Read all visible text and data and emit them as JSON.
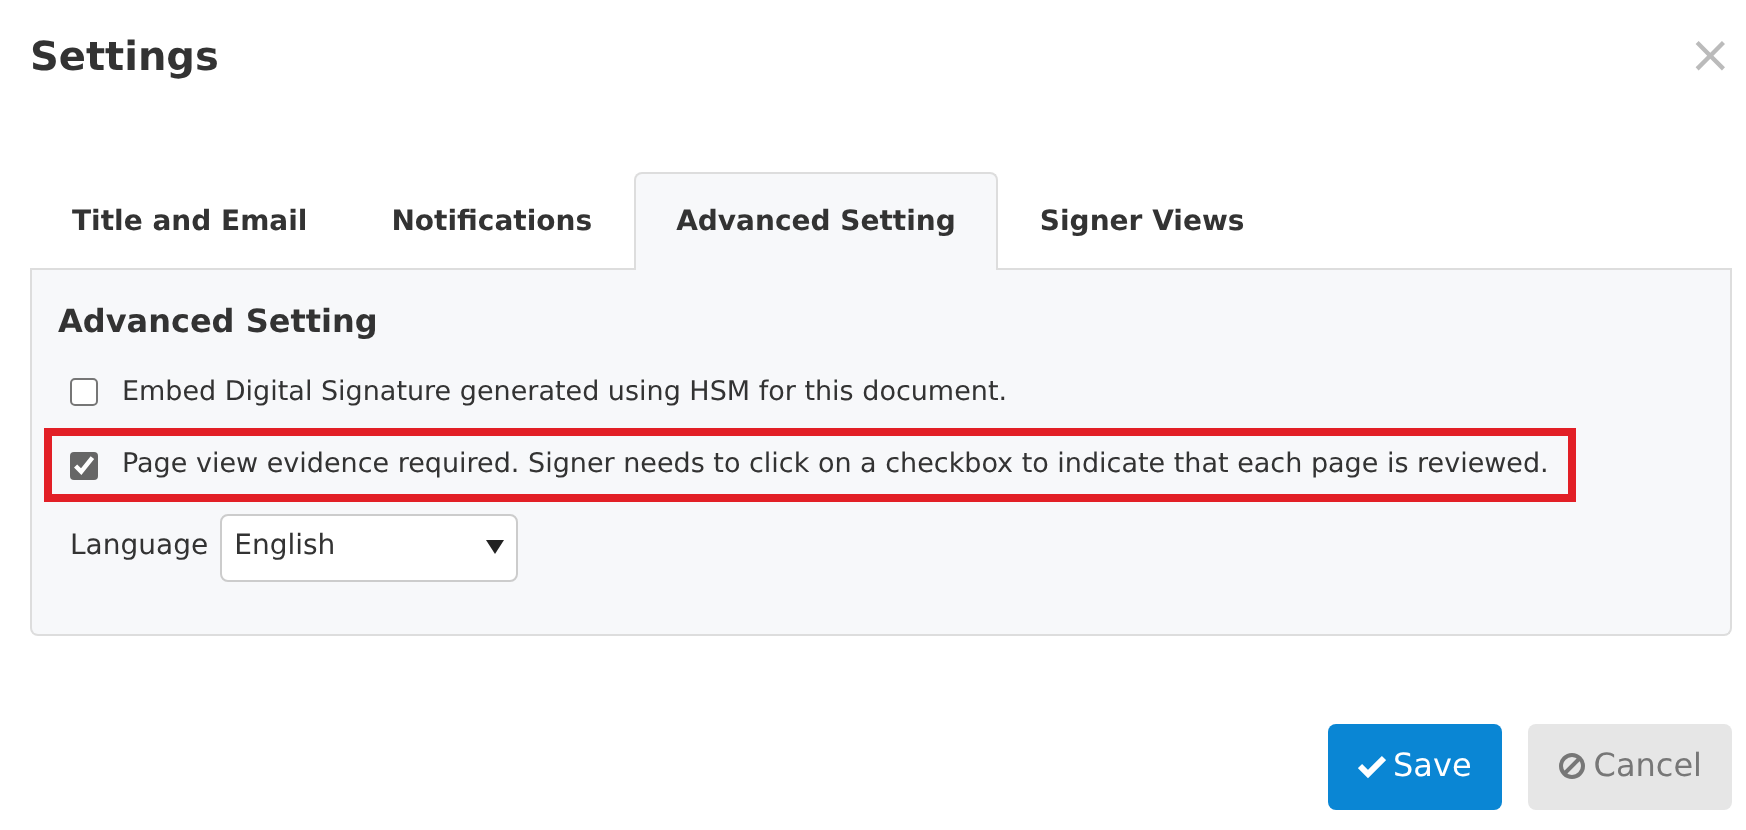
{
  "dialog": {
    "title": "Settings",
    "close": "×"
  },
  "tabs": [
    {
      "label": "Title and Email",
      "selected": false
    },
    {
      "label": "Notifications",
      "selected": false
    },
    {
      "label": "Advanced Setting",
      "selected": true
    },
    {
      "label": "Signer Views",
      "selected": false
    }
  ],
  "panel": {
    "heading": "Advanced Setting",
    "options": [
      {
        "label": "Embed Digital Signature generated using HSM for this document.",
        "checked": false,
        "highlighted": false
      },
      {
        "label": "Page view evidence required. Signer needs to click on a checkbox to indicate that each page is reviewed.",
        "checked": true,
        "highlighted": true
      }
    ],
    "language": {
      "label": "Language",
      "value": "English"
    }
  },
  "buttons": [
    {
      "label": "Save",
      "kind": "primary"
    },
    {
      "label": "Cancel",
      "kind": "secondary"
    }
  ]
}
